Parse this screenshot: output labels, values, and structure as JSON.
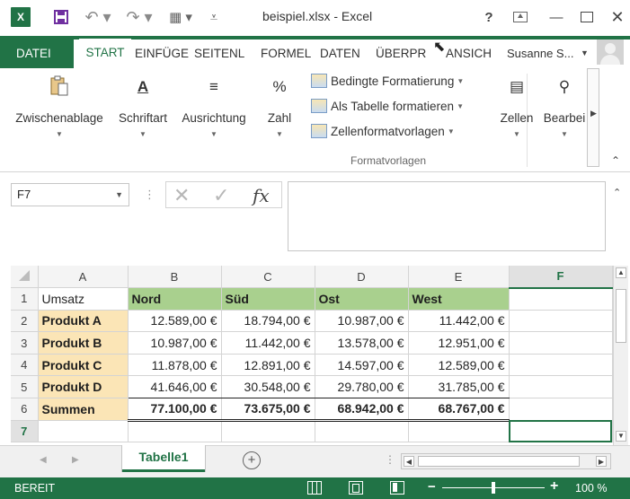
{
  "window": {
    "title": "beispiel.xlsx - Excel",
    "help": "?"
  },
  "tabs": [
    {
      "label": "DATEI"
    },
    {
      "label": "START"
    },
    {
      "label": "EINFÜGE"
    },
    {
      "label": "SEITENL"
    },
    {
      "label": "FORMEL"
    },
    {
      "label": "DATEN"
    },
    {
      "label": "ÜBERPR"
    },
    {
      "label": "ANSICH"
    }
  ],
  "user": {
    "name": "Susanne S..."
  },
  "ribbon": {
    "clipboard": "Zwischenablage",
    "font": "Schriftart",
    "alignment": "Ausrichtung",
    "number": "Zahl",
    "conditional": "Bedingte Formatierung",
    "as_table": "Als Tabelle formatieren",
    "cell_styles": "Zellenformatvorlagen",
    "styles_group": "Formatvorlagen",
    "cells": "Zellen",
    "editing": "Bearbei",
    "font_icon": "A",
    "number_icon": "%"
  },
  "formula_bar": {
    "name_box": "F7",
    "fx": "fx",
    "content": ""
  },
  "grid": {
    "columns": [
      "A",
      "B",
      "C",
      "D",
      "E",
      "F"
    ],
    "rows": [
      {
        "n": "1",
        "a": "Umsatz",
        "b": "Nord",
        "c": "Süd",
        "d": "Ost",
        "e": "West",
        "f": ""
      },
      {
        "n": "2",
        "a": "Produkt A",
        "b": "12.589,00 €",
        "c": "18.794,00 €",
        "d": "10.987,00 €",
        "e": "11.442,00 €",
        "f": ""
      },
      {
        "n": "3",
        "a": "Produkt B",
        "b": "10.987,00 €",
        "c": "11.442,00 €",
        "d": "13.578,00 €",
        "e": "12.951,00 €",
        "f": ""
      },
      {
        "n": "4",
        "a": "Produkt C",
        "b": "11.878,00 €",
        "c": "12.891,00 €",
        "d": "14.597,00 €",
        "e": "12.589,00 €",
        "f": ""
      },
      {
        "n": "5",
        "a": "Produkt D",
        "b": "41.646,00 €",
        "c": "30.548,00 €",
        "d": "29.780,00 €",
        "e": "31.785,00 €",
        "f": ""
      },
      {
        "n": "6",
        "a": "Summen",
        "b": "77.100,00 €",
        "c": "73.675,00 €",
        "d": "68.942,00 €",
        "e": "68.767,00 €",
        "f": ""
      },
      {
        "n": "7",
        "a": "",
        "b": "",
        "c": "",
        "d": "",
        "e": "",
        "f": ""
      }
    ],
    "active_cell": "F7"
  },
  "sheets": [
    {
      "label": "Tabelle1"
    }
  ],
  "status": {
    "ready": "BEREIT",
    "zoom": "100 %",
    "zoom_fraction": 0.5
  },
  "colors": {
    "accent": "#217346",
    "header_fill": "#a9d08e",
    "product_fill": "#fbe5b6"
  }
}
